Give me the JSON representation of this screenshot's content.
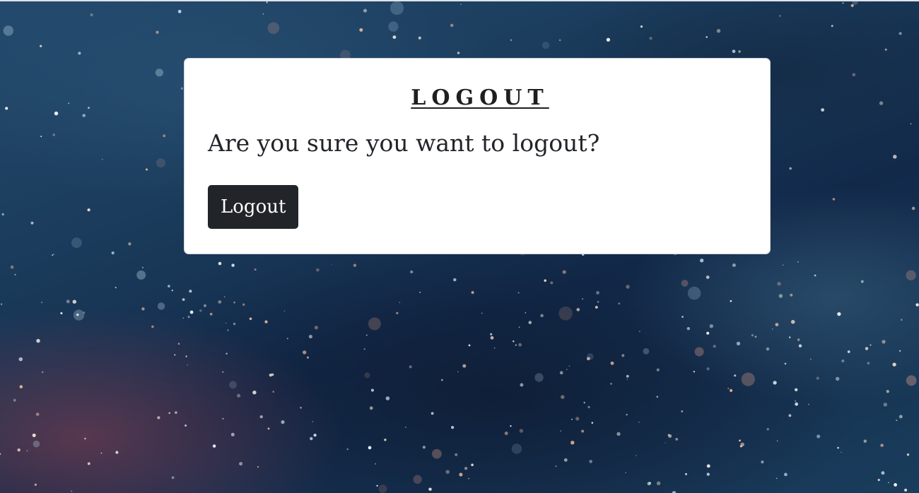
{
  "logout": {
    "title": "LOGOUT",
    "question": "Are you sure you want to logout?",
    "button_label": "Logout"
  },
  "colors": {
    "button_bg": "#212529",
    "card_bg": "#ffffff",
    "text": "#212529"
  }
}
